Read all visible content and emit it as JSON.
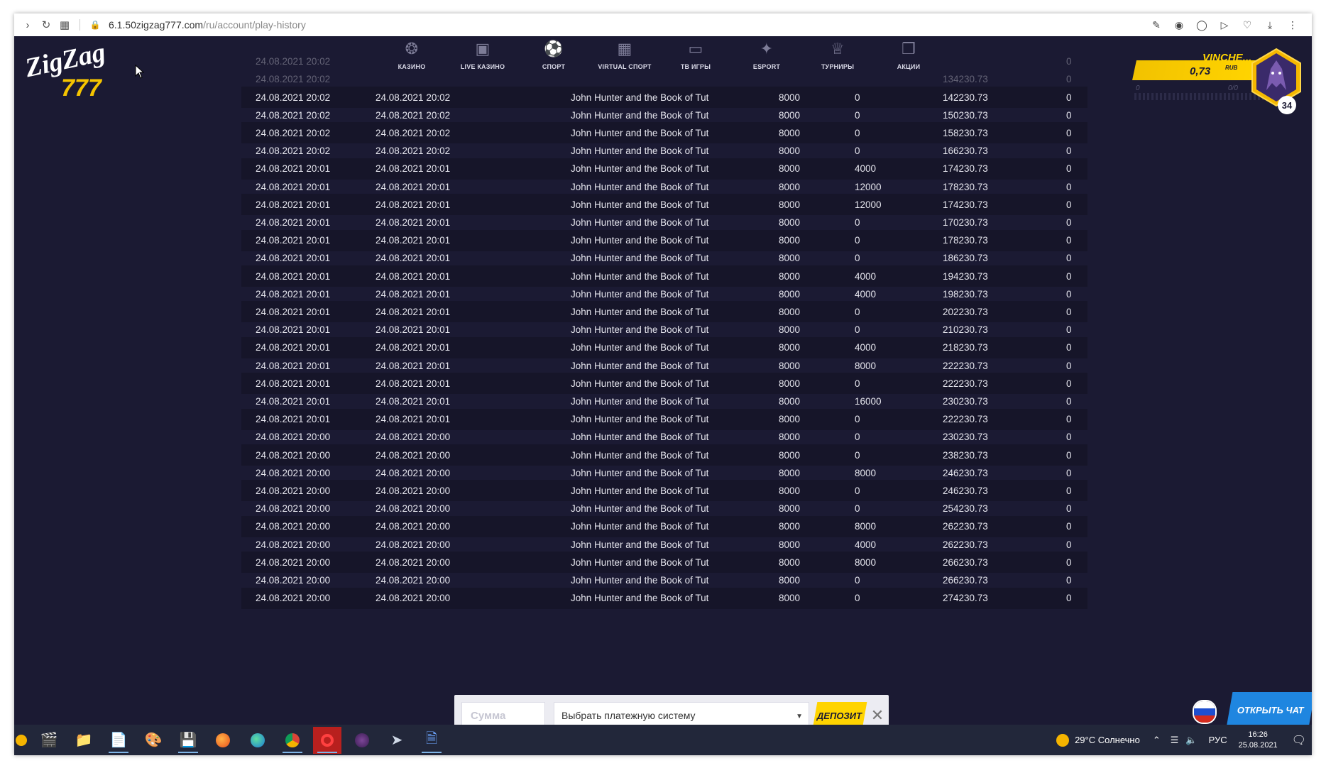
{
  "browser": {
    "url_main": "6.1.50zigzag777.com",
    "url_path": "/ru/account/play-history",
    "icons": [
      "back-icon",
      "reload-icon",
      "tabs-grid-icon",
      "lock-icon",
      "share-icon",
      "camera-icon",
      "shield-icon",
      "send-icon",
      "heart-icon",
      "download-icon",
      "more-icon"
    ]
  },
  "site": {
    "logo_top": "ZigZag",
    "logo_bottom": "777"
  },
  "nav": {
    "items": [
      {
        "label": "КАЗИНО",
        "icon": "casino-chip-icon"
      },
      {
        "label": "LIVE КАЗИНО",
        "icon": "live-icon"
      },
      {
        "label": "СПОРТ",
        "icon": "soccer-ball-icon"
      },
      {
        "label": "VIRTUAL СПОРТ",
        "icon": "scoreboard-icon"
      },
      {
        "label": "ТВ ИГРЫ",
        "icon": "tv-icon"
      },
      {
        "label": "ESPORT",
        "icon": "gamepad-icon"
      },
      {
        "label": "ТУРНИРЫ",
        "icon": "trophy-icon"
      },
      {
        "label": "АКЦИИ",
        "icon": "gift-icon"
      }
    ]
  },
  "user": {
    "name": "VINCHE...",
    "balance": "0,73",
    "currency": "RUB",
    "progress_start": "0",
    "progress_ratio": "0/0",
    "level": "34"
  },
  "history": {
    "rows": [
      [
        "24.08.2021 20:02",
        "24.08.2021 20:02",
        "John Hunter and the Book of Tut",
        "8000",
        "0",
        "142230.73",
        "0"
      ],
      [
        "24.08.2021 20:02",
        "24.08.2021 20:02",
        "John Hunter and the Book of Tut",
        "8000",
        "0",
        "150230.73",
        "0"
      ],
      [
        "24.08.2021 20:02",
        "24.08.2021 20:02",
        "John Hunter and the Book of Tut",
        "8000",
        "0",
        "158230.73",
        "0"
      ],
      [
        "24.08.2021 20:02",
        "24.08.2021 20:02",
        "John Hunter and the Book of Tut",
        "8000",
        "0",
        "166230.73",
        "0"
      ],
      [
        "24.08.2021 20:01",
        "24.08.2021 20:01",
        "John Hunter and the Book of Tut",
        "8000",
        "4000",
        "174230.73",
        "0"
      ],
      [
        "24.08.2021 20:01",
        "24.08.2021 20:01",
        "John Hunter and the Book of Tut",
        "8000",
        "12000",
        "178230.73",
        "0"
      ],
      [
        "24.08.2021 20:01",
        "24.08.2021 20:01",
        "John Hunter and the Book of Tut",
        "8000",
        "12000",
        "174230.73",
        "0"
      ],
      [
        "24.08.2021 20:01",
        "24.08.2021 20:01",
        "John Hunter and the Book of Tut",
        "8000",
        "0",
        "170230.73",
        "0"
      ],
      [
        "24.08.2021 20:01",
        "24.08.2021 20:01",
        "John Hunter and the Book of Tut",
        "8000",
        "0",
        "178230.73",
        "0"
      ],
      [
        "24.08.2021 20:01",
        "24.08.2021 20:01",
        "John Hunter and the Book of Tut",
        "8000",
        "0",
        "186230.73",
        "0"
      ],
      [
        "24.08.2021 20:01",
        "24.08.2021 20:01",
        "John Hunter and the Book of Tut",
        "8000",
        "4000",
        "194230.73",
        "0"
      ],
      [
        "24.08.2021 20:01",
        "24.08.2021 20:01",
        "John Hunter and the Book of Tut",
        "8000",
        "4000",
        "198230.73",
        "0"
      ],
      [
        "24.08.2021 20:01",
        "24.08.2021 20:01",
        "John Hunter and the Book of Tut",
        "8000",
        "0",
        "202230.73",
        "0"
      ],
      [
        "24.08.2021 20:01",
        "24.08.2021 20:01",
        "John Hunter and the Book of Tut",
        "8000",
        "0",
        "210230.73",
        "0"
      ],
      [
        "24.08.2021 20:01",
        "24.08.2021 20:01",
        "John Hunter and the Book of Tut",
        "8000",
        "4000",
        "218230.73",
        "0"
      ],
      [
        "24.08.2021 20:01",
        "24.08.2021 20:01",
        "John Hunter and the Book of Tut",
        "8000",
        "8000",
        "222230.73",
        "0"
      ],
      [
        "24.08.2021 20:01",
        "24.08.2021 20:01",
        "John Hunter and the Book of Tut",
        "8000",
        "0",
        "222230.73",
        "0"
      ],
      [
        "24.08.2021 20:01",
        "24.08.2021 20:01",
        "John Hunter and the Book of Tut",
        "8000",
        "16000",
        "230230.73",
        "0"
      ],
      [
        "24.08.2021 20:01",
        "24.08.2021 20:01",
        "John Hunter and the Book of Tut",
        "8000",
        "0",
        "222230.73",
        "0"
      ],
      [
        "24.08.2021 20:00",
        "24.08.2021 20:00",
        "John Hunter and the Book of Tut",
        "8000",
        "0",
        "230230.73",
        "0"
      ],
      [
        "24.08.2021 20:00",
        "24.08.2021 20:00",
        "John Hunter and the Book of Tut",
        "8000",
        "0",
        "238230.73",
        "0"
      ],
      [
        "24.08.2021 20:00",
        "24.08.2021 20:00",
        "John Hunter and the Book of Tut",
        "8000",
        "8000",
        "246230.73",
        "0"
      ],
      [
        "24.08.2021 20:00",
        "24.08.2021 20:00",
        "John Hunter and the Book of Tut",
        "8000",
        "0",
        "246230.73",
        "0"
      ],
      [
        "24.08.2021 20:00",
        "24.08.2021 20:00",
        "John Hunter and the Book of Tut",
        "8000",
        "0",
        "254230.73",
        "0"
      ],
      [
        "24.08.2021 20:00",
        "24.08.2021 20:00",
        "John Hunter and the Book of Tut",
        "8000",
        "8000",
        "262230.73",
        "0"
      ],
      [
        "24.08.2021 20:00",
        "24.08.2021 20:00",
        "John Hunter and the Book of Tut",
        "8000",
        "4000",
        "262230.73",
        "0"
      ],
      [
        "24.08.2021 20:00",
        "24.08.2021 20:00",
        "John Hunter and the Book of Tut",
        "8000",
        "8000",
        "266230.73",
        "0"
      ],
      [
        "24.08.2021 20:00",
        "24.08.2021 20:00",
        "John Hunter and the Book of Tut",
        "8000",
        "0",
        "266230.73",
        "0"
      ],
      [
        "24.08.2021 20:00",
        "24.08.2021 20:00",
        "John Hunter and the Book of Tut",
        "8000",
        "0",
        "274230.73",
        "0"
      ]
    ],
    "top_partial_rows": [
      [
        "24.08.2021 20:02",
        "",
        "",
        "",
        "",
        "",
        "0"
      ],
      [
        "24.08.2021 20:02",
        "",
        "",
        "",
        "",
        "134230.73",
        "0"
      ]
    ]
  },
  "deposit": {
    "amount_placeholder": "Сумма",
    "payment_placeholder": "Выбрать платежную систему",
    "button_label": "ДЕПОЗИТ"
  },
  "chat": {
    "button_label": "ОТКРЫТЬ ЧАТ",
    "flag_icon": "russia-flag-icon"
  },
  "taskbar": {
    "weather": "29°C  Солнечно",
    "language": "РУС",
    "time": "16:26",
    "date": "25.08.2021"
  }
}
